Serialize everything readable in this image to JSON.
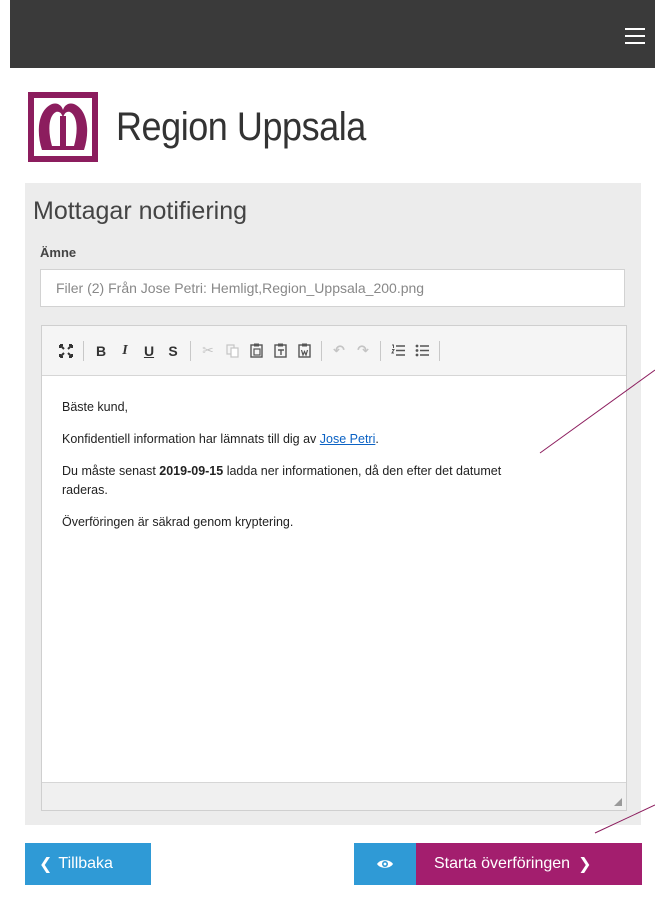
{
  "header": {
    "menu_icon": "hamburger-icon"
  },
  "brand": {
    "name": "Region Uppsala",
    "color": "#8c1d5e"
  },
  "form": {
    "title": "Mottagar notifiering",
    "subject_label": "Ämne",
    "subject_value": "Filer (2) Från Jose Petri: Hemligt,Region_Uppsala_200.png"
  },
  "editor": {
    "toolbar": [
      "maximize-icon",
      "bold-icon",
      "italic-icon",
      "underline-icon",
      "strikethrough-icon",
      "cut-icon",
      "copy-icon",
      "paste-icon",
      "paste-text-icon",
      "paste-word-icon",
      "undo-icon",
      "redo-icon",
      "numbered-list-icon",
      "bulleted-list-icon"
    ],
    "greeting": "Bäste kund,",
    "line1_prefix": "Konfidentiell information har lämnats till dig av ",
    "line1_link": "Jose Petri",
    "line1_suffix": ".",
    "line2_prefix": "Du måste senast ",
    "line2_date": "2019-09-15",
    "line2_suffix": " ladda ner informationen, då den efter det datumet raderas.",
    "line3": "Överföringen är säkrad genom kryptering."
  },
  "actions": {
    "back_label": "Tillbaka",
    "start_label": "Starta överföringen",
    "preview_icon": "eye-icon"
  },
  "colors": {
    "accent_blue": "#2f9ad6",
    "accent_purple": "#a31e6e",
    "topbar": "#3a3a3a"
  }
}
